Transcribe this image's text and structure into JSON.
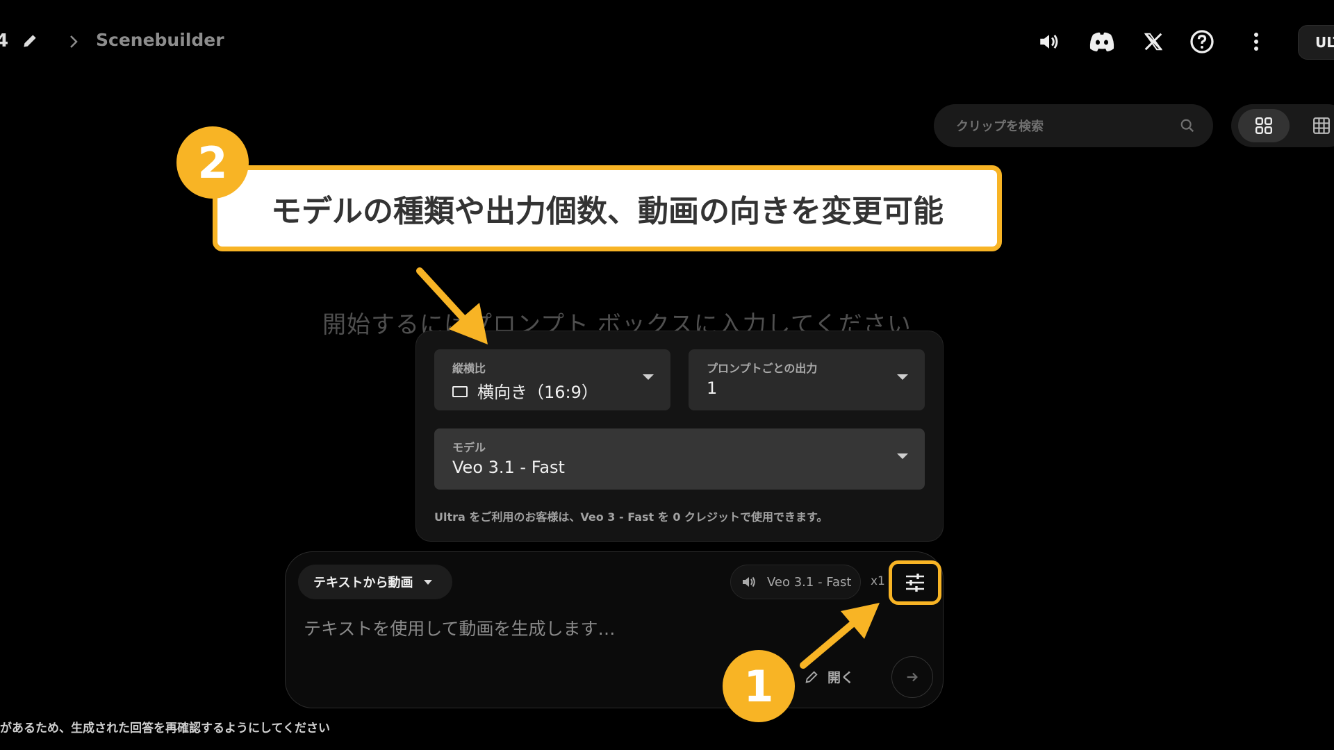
{
  "header": {
    "crumb_number": "4",
    "crumb_title": "Scenebuilder",
    "plan_badge": "ULT",
    "icons": [
      "speaker-icon",
      "discord-icon",
      "x-icon",
      "help-icon",
      "more-vert-icon"
    ]
  },
  "search": {
    "placeholder": "クリップを検索"
  },
  "background_hint": "開始するにはプロンプト ボックスに入力してください",
  "settings_panel": {
    "aspect_label": "縦横比",
    "aspect_value": "横向き（16:9）",
    "outputs_label": "プロンプトごとの出力",
    "outputs_value": "1",
    "model_label": "モデル",
    "model_value": "Veo 3.1 - Fast",
    "note": "Ultra をご利用のお客様は、Veo 3 - Fast を 0 クレジットで使用できます。"
  },
  "prompt": {
    "mode_label": "テキストから動画",
    "model_chip": "Veo 3.1 - Fast",
    "count_label": "x1",
    "placeholder": "テキストを使用して動画を生成します…",
    "open_label": "開く"
  },
  "disclaimer": "があるため、生成された回答を再確認するようにしてください",
  "annotations": {
    "callout_text": "モデルの種類や出力個数、動画の向きを変更可能",
    "step1": "1",
    "step2": "2",
    "accent_color": "#f8b425"
  }
}
